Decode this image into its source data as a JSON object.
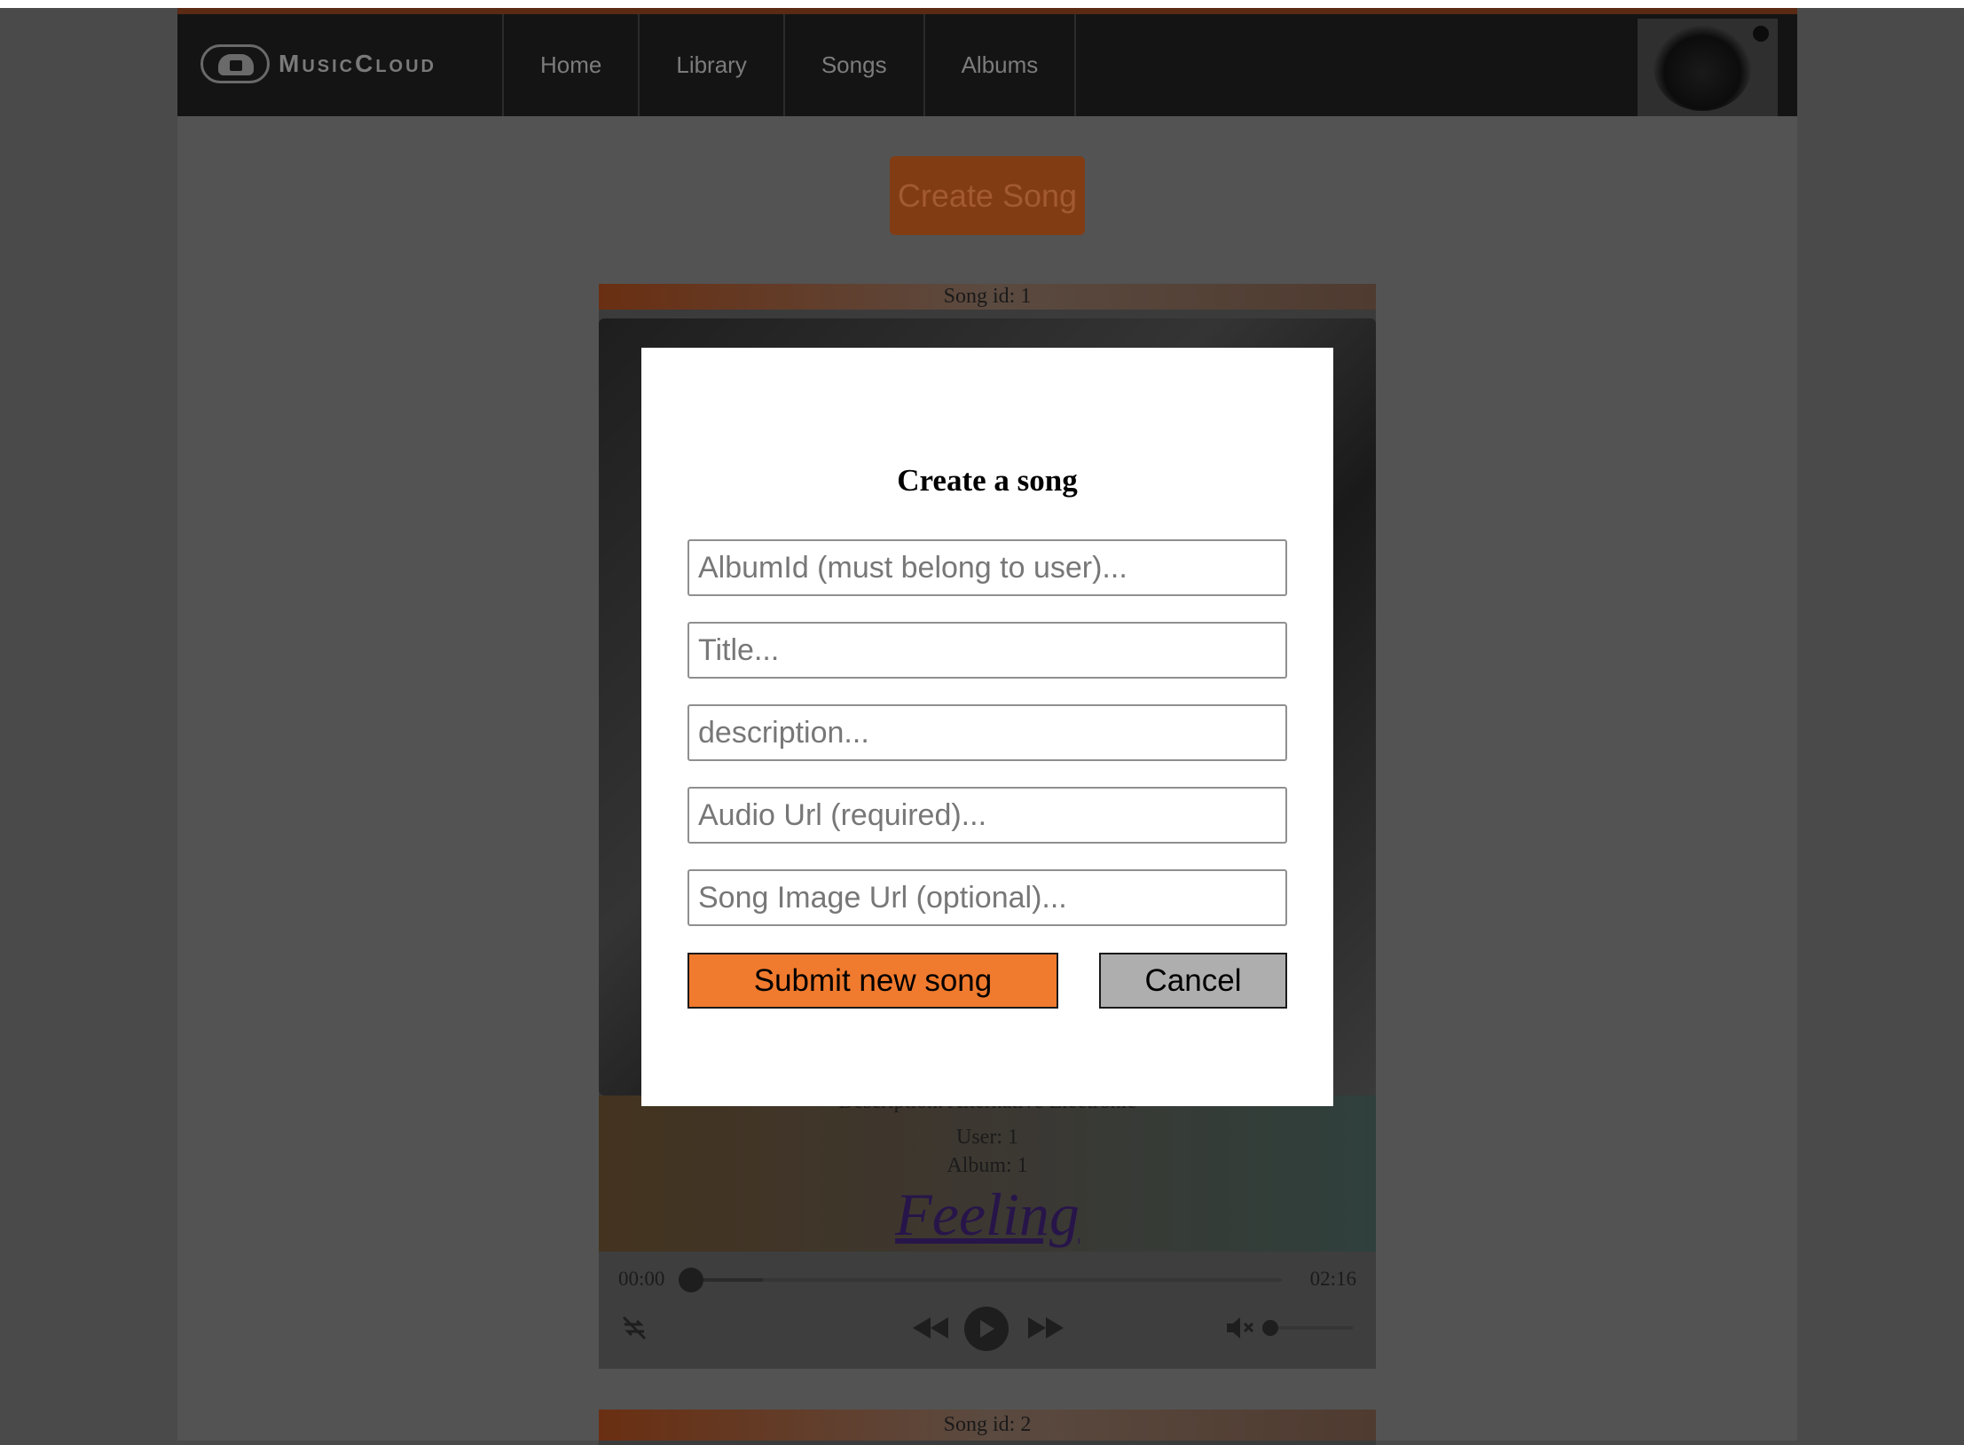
{
  "header": {
    "brand": "MusicCloud",
    "nav": [
      "Home",
      "Library",
      "Songs",
      "Albums"
    ]
  },
  "main": {
    "create_button": "Create Song",
    "cards": [
      {
        "head": "Song id: 1",
        "description": "Description: Alternative Electronic",
        "user": "User: 1",
        "album": "Album: 1",
        "title": "Feeling",
        "player": {
          "current_time": "00:00",
          "duration": "02:16",
          "progress": 0,
          "volume": 0
        }
      },
      {
        "head": "Song id: 2"
      }
    ]
  },
  "modal": {
    "title": "Create a song",
    "fields": [
      {
        "placeholder": "AlbumId (must belong to user)..."
      },
      {
        "placeholder": "Title..."
      },
      {
        "placeholder": "description..."
      },
      {
        "placeholder": "Audio Url (required)..."
      },
      {
        "placeholder": "Song Image Url (optional)..."
      }
    ],
    "submit_label": "Submit new song",
    "cancel_label": "Cancel"
  },
  "colors": {
    "accent": "#f07a2e",
    "overlay": "#4a4a4a"
  }
}
